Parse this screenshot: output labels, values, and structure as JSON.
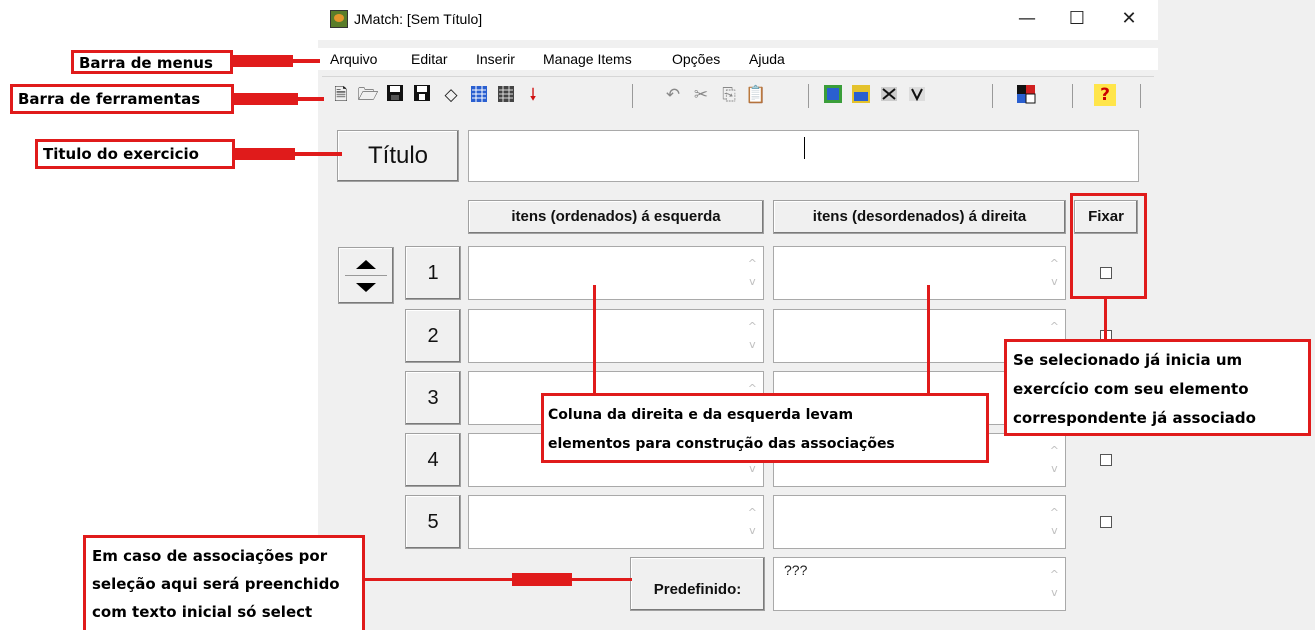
{
  "window": {
    "title": "JMatch: [Sem Título]",
    "controls": {
      "minimize": "—",
      "maximize": "☐",
      "close": "✕"
    }
  },
  "menu": [
    "Arquivo",
    "Editar",
    "Inserir",
    "Manage Items",
    "Opções",
    "Ajuda"
  ],
  "toolbar_icons": [
    "new-file-icon",
    "open-folder-icon",
    "save-icon",
    "save-as-icon",
    "clear-icon",
    "export-web-icon",
    "export-web-alt-icon",
    "down-arrow-icon",
    "undo-icon",
    "cut-icon",
    "copy-icon",
    "paste-icon",
    "add-exercise-icon",
    "edit-exercise-icon",
    "exercise-tool-icon",
    "exercise-tool-alt-icon",
    "config-icon",
    "help-icon"
  ],
  "form": {
    "title_button": "Título",
    "title_value": "",
    "col_left": "itens (ordenados) á esquerda",
    "col_right": "itens (desordenados) á direita",
    "col_fix": "Fixar",
    "rows": [
      "1",
      "2",
      "3",
      "4",
      "5"
    ],
    "default_button": "Predefinido:",
    "default_value": "???"
  },
  "annotations": {
    "menu_bar": "Barra de menus",
    "toolbar": "Barra de ferramentas",
    "title": "Titulo do exercicio",
    "columns": [
      "Coluna da direita e da esquerda levam",
      "elementos para construção das associações"
    ],
    "fix": [
      "Se selecionado já inicia um",
      "exercício com seu elemento",
      "correspondente já associado"
    ],
    "default": [
      "Em caso de associações por",
      "seleção aqui será preenchido",
      "com texto inicial só select"
    ]
  },
  "colors": {
    "annotation_red": "#e01b1b",
    "window_bg": "#f0f0f0"
  }
}
